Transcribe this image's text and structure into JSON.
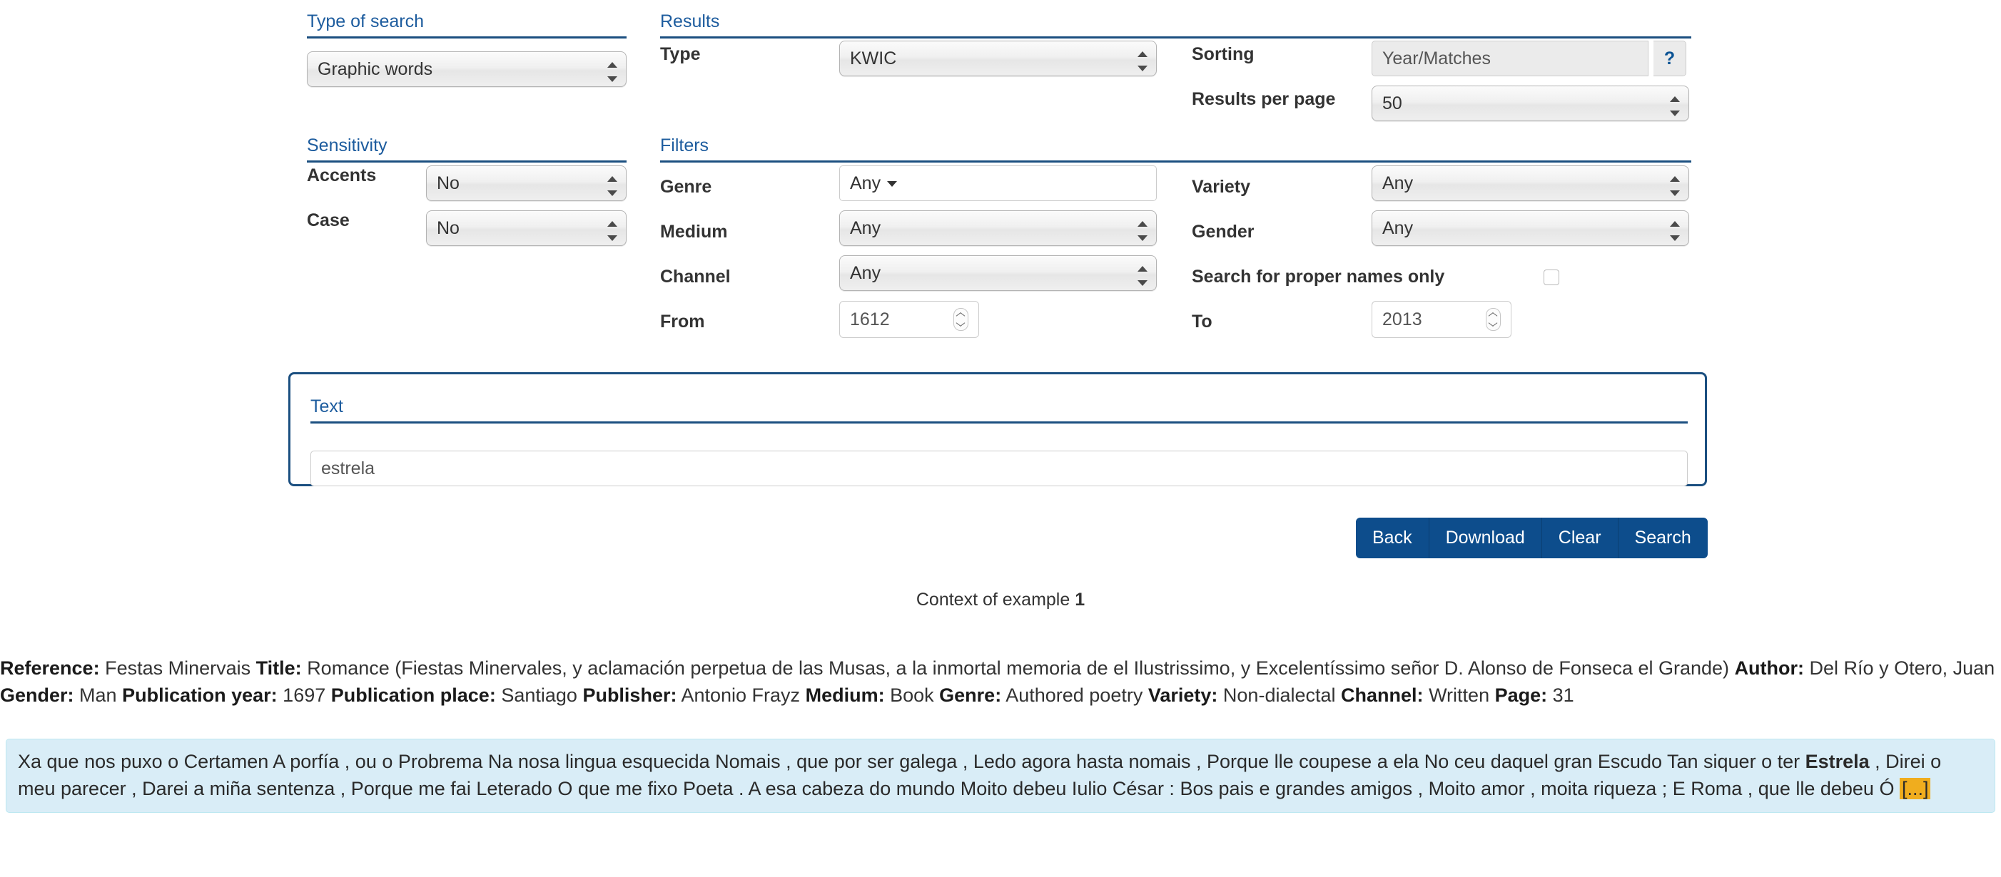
{
  "sections": {
    "type_of_search": {
      "legend": "Type of search",
      "value": "Graphic words"
    },
    "results": {
      "legend": "Results",
      "type_label": "Type",
      "type_value": "KWIC",
      "sorting_label": "Sorting",
      "sorting_value": "Year/Matches",
      "sorting_help": "?",
      "per_page_label": "Results per page",
      "per_page_value": "50"
    },
    "sensitivity": {
      "legend": "Sensitivity",
      "accents_label": "Accents",
      "accents_value": "No",
      "case_label": "Case",
      "case_value": "No"
    },
    "filters": {
      "legend": "Filters",
      "genre_label": "Genre",
      "genre_value": "Any",
      "medium_label": "Medium",
      "medium_value": "Any",
      "channel_label": "Channel",
      "channel_value": "Any",
      "from_label": "From",
      "from_value": "1612",
      "variety_label": "Variety",
      "variety_value": "Any",
      "gender_label": "Gender",
      "gender_value": "Any",
      "proper_names_label": "Search for proper names only",
      "to_label": "To",
      "to_value": "2013"
    },
    "text": {
      "legend": "Text",
      "value": "estrela"
    }
  },
  "actions": {
    "back": "Back",
    "download": "Download",
    "clear": "Clear",
    "search": "Search"
  },
  "context": {
    "label": "Context of example",
    "number": "1"
  },
  "reference": {
    "reference_label": "Reference:",
    "reference_value": "Festas Minervais",
    "title_label": "Title:",
    "title_value": "Romance (Fiestas Minervales, y aclamación perpetua de las Musas, a la inmortal memoria de el Ilustrissimo, y Excelentíssimo señor D. Alonso de Fonseca el Grande)",
    "author_label": "Author:",
    "author_value": "Del Río y Otero, Juan",
    "gender_label": "Gender:",
    "gender_value": "Man",
    "pub_year_label": "Publication year:",
    "pub_year_value": "1697",
    "pub_place_label": "Publication place:",
    "pub_place_value": "Santiago",
    "publisher_label": "Publisher:",
    "publisher_value": "Antonio Frayz",
    "medium_label": "Medium:",
    "medium_value": "Book",
    "genre_label": "Genre:",
    "genre_value": "Authored poetry",
    "variety_label": "Variety:",
    "variety_value": "Non-dialectal",
    "channel_label": "Channel:",
    "channel_value": "Written",
    "page_label": "Page:",
    "page_value": "31"
  },
  "kwic": {
    "before": "Xa que nos puxo o Certamen A porfía , ou o Probrema Na nosa lingua esquecida Nomais , que por ser galega , Ledo agora hasta nomais , Porque lle coupese a ela No ceu daquel gran Escudo Tan siquer o ter ",
    "keyword": "Estrela",
    "after": " , Direi o meu parecer , Darei a miña sentenza , Porque me fai Leterado O que me fixo Poeta . A esa cabeza do mundo Moito debeu Iulio César : Bos pais e grandes amigos , Moito amor , moita riqueza ; E Roma , que lle debeu Ó ",
    "ellipsis": "[...]"
  },
  "colors": {
    "legend_text": "#1d5c9e",
    "legend_rule": "#1b4f80",
    "button_blue": "#0d4d8c",
    "kwic_background": "#d9edf7",
    "kwic_border": "#bce8f1",
    "highlight_orange": "#f0ad1e"
  }
}
